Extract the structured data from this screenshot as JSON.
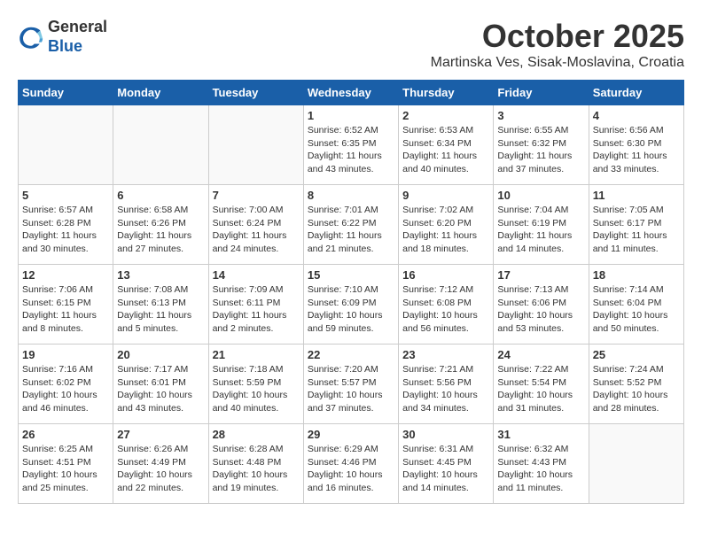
{
  "header": {
    "logo_line1": "General",
    "logo_line2": "Blue",
    "month_title": "October 2025",
    "location": "Martinska Ves, Sisak-Moslavina, Croatia"
  },
  "weekdays": [
    "Sunday",
    "Monday",
    "Tuesday",
    "Wednesday",
    "Thursday",
    "Friday",
    "Saturday"
  ],
  "weeks": [
    [
      {
        "day": "",
        "info": ""
      },
      {
        "day": "",
        "info": ""
      },
      {
        "day": "",
        "info": ""
      },
      {
        "day": "1",
        "info": "Sunrise: 6:52 AM\nSunset: 6:35 PM\nDaylight: 11 hours\nand 43 minutes."
      },
      {
        "day": "2",
        "info": "Sunrise: 6:53 AM\nSunset: 6:34 PM\nDaylight: 11 hours\nand 40 minutes."
      },
      {
        "day": "3",
        "info": "Sunrise: 6:55 AM\nSunset: 6:32 PM\nDaylight: 11 hours\nand 37 minutes."
      },
      {
        "day": "4",
        "info": "Sunrise: 6:56 AM\nSunset: 6:30 PM\nDaylight: 11 hours\nand 33 minutes."
      }
    ],
    [
      {
        "day": "5",
        "info": "Sunrise: 6:57 AM\nSunset: 6:28 PM\nDaylight: 11 hours\nand 30 minutes."
      },
      {
        "day": "6",
        "info": "Sunrise: 6:58 AM\nSunset: 6:26 PM\nDaylight: 11 hours\nand 27 minutes."
      },
      {
        "day": "7",
        "info": "Sunrise: 7:00 AM\nSunset: 6:24 PM\nDaylight: 11 hours\nand 24 minutes."
      },
      {
        "day": "8",
        "info": "Sunrise: 7:01 AM\nSunset: 6:22 PM\nDaylight: 11 hours\nand 21 minutes."
      },
      {
        "day": "9",
        "info": "Sunrise: 7:02 AM\nSunset: 6:20 PM\nDaylight: 11 hours\nand 18 minutes."
      },
      {
        "day": "10",
        "info": "Sunrise: 7:04 AM\nSunset: 6:19 PM\nDaylight: 11 hours\nand 14 minutes."
      },
      {
        "day": "11",
        "info": "Sunrise: 7:05 AM\nSunset: 6:17 PM\nDaylight: 11 hours\nand 11 minutes."
      }
    ],
    [
      {
        "day": "12",
        "info": "Sunrise: 7:06 AM\nSunset: 6:15 PM\nDaylight: 11 hours\nand 8 minutes."
      },
      {
        "day": "13",
        "info": "Sunrise: 7:08 AM\nSunset: 6:13 PM\nDaylight: 11 hours\nand 5 minutes."
      },
      {
        "day": "14",
        "info": "Sunrise: 7:09 AM\nSunset: 6:11 PM\nDaylight: 11 hours\nand 2 minutes."
      },
      {
        "day": "15",
        "info": "Sunrise: 7:10 AM\nSunset: 6:09 PM\nDaylight: 10 hours\nand 59 minutes."
      },
      {
        "day": "16",
        "info": "Sunrise: 7:12 AM\nSunset: 6:08 PM\nDaylight: 10 hours\nand 56 minutes."
      },
      {
        "day": "17",
        "info": "Sunrise: 7:13 AM\nSunset: 6:06 PM\nDaylight: 10 hours\nand 53 minutes."
      },
      {
        "day": "18",
        "info": "Sunrise: 7:14 AM\nSunset: 6:04 PM\nDaylight: 10 hours\nand 50 minutes."
      }
    ],
    [
      {
        "day": "19",
        "info": "Sunrise: 7:16 AM\nSunset: 6:02 PM\nDaylight: 10 hours\nand 46 minutes."
      },
      {
        "day": "20",
        "info": "Sunrise: 7:17 AM\nSunset: 6:01 PM\nDaylight: 10 hours\nand 43 minutes."
      },
      {
        "day": "21",
        "info": "Sunrise: 7:18 AM\nSunset: 5:59 PM\nDaylight: 10 hours\nand 40 minutes."
      },
      {
        "day": "22",
        "info": "Sunrise: 7:20 AM\nSunset: 5:57 PM\nDaylight: 10 hours\nand 37 minutes."
      },
      {
        "day": "23",
        "info": "Sunrise: 7:21 AM\nSunset: 5:56 PM\nDaylight: 10 hours\nand 34 minutes."
      },
      {
        "day": "24",
        "info": "Sunrise: 7:22 AM\nSunset: 5:54 PM\nDaylight: 10 hours\nand 31 minutes."
      },
      {
        "day": "25",
        "info": "Sunrise: 7:24 AM\nSunset: 5:52 PM\nDaylight: 10 hours\nand 28 minutes."
      }
    ],
    [
      {
        "day": "26",
        "info": "Sunrise: 6:25 AM\nSunset: 4:51 PM\nDaylight: 10 hours\nand 25 minutes."
      },
      {
        "day": "27",
        "info": "Sunrise: 6:26 AM\nSunset: 4:49 PM\nDaylight: 10 hours\nand 22 minutes."
      },
      {
        "day": "28",
        "info": "Sunrise: 6:28 AM\nSunset: 4:48 PM\nDaylight: 10 hours\nand 19 minutes."
      },
      {
        "day": "29",
        "info": "Sunrise: 6:29 AM\nSunset: 4:46 PM\nDaylight: 10 hours\nand 16 minutes."
      },
      {
        "day": "30",
        "info": "Sunrise: 6:31 AM\nSunset: 4:45 PM\nDaylight: 10 hours\nand 14 minutes."
      },
      {
        "day": "31",
        "info": "Sunrise: 6:32 AM\nSunset: 4:43 PM\nDaylight: 10 hours\nand 11 minutes."
      },
      {
        "day": "",
        "info": ""
      }
    ]
  ]
}
